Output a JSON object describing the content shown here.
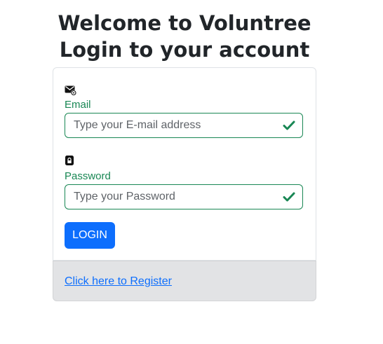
{
  "heading": {
    "line1": "Welcome to Voluntree",
    "line2": "Login to your account"
  },
  "form": {
    "email": {
      "icon": "envelope-at-icon",
      "label": "Email",
      "placeholder": "Type your E-mail address",
      "value": "",
      "valid": true
    },
    "password": {
      "icon": "lock-icon",
      "label": "Password",
      "placeholder": "Type your Password",
      "value": "",
      "valid": true
    },
    "submit_label": "LOGIN"
  },
  "footer": {
    "register_link": "Click here to Register"
  },
  "colors": {
    "valid": "#198754",
    "primary": "#0d6efd",
    "footer_bg": "#e2e3e5"
  }
}
